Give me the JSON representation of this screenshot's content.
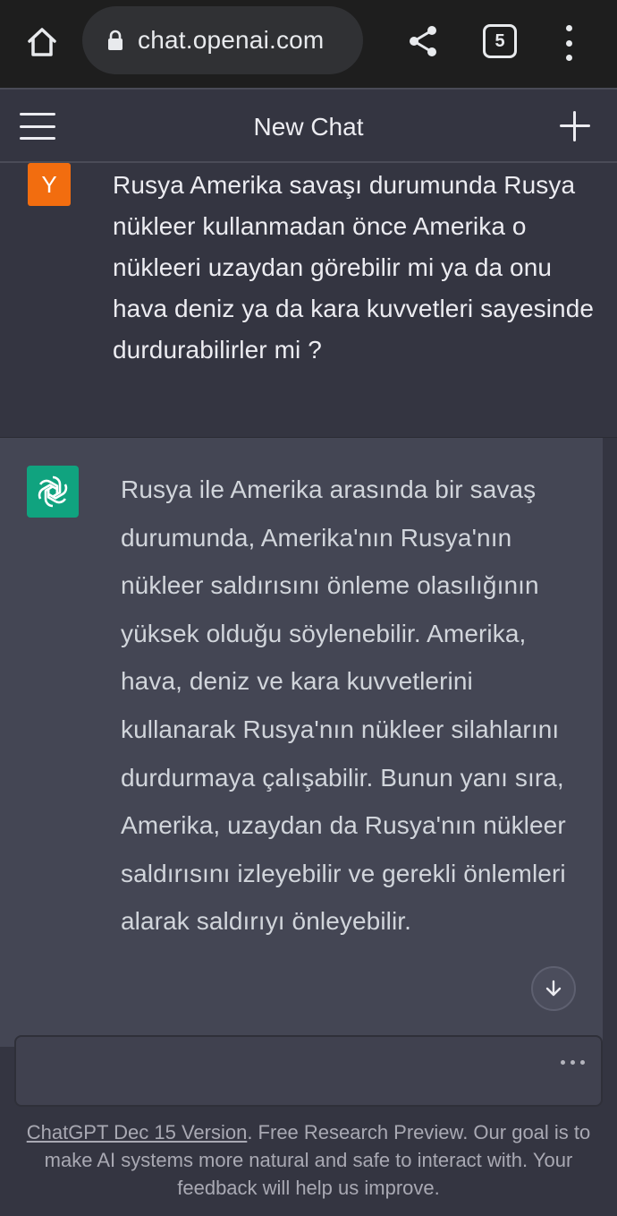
{
  "browser": {
    "url": "chat.openai.com",
    "tab_count": "5"
  },
  "header": {
    "title": "New Chat"
  },
  "conversation": {
    "user_avatar_letter": "Y",
    "user_message": "Rusya Amerika savaşı durumunda Rusya nükleer kullanmadan önce Amerika o nükleeri uzaydan görebilir mi ya da onu hava deniz ya da kara kuvvetleri sayesinde durdurabilirler mi ?",
    "assistant_message": "Rusya ile Amerika arasında bir savaş durumunda, Amerika'nın Rusya'nın nükleer saldırısını önleme olasılığının yüksek olduğu söylenebilir. Amerika, hava, deniz ve kara kuvvetlerini kullanarak Rusya'nın nükleer silahlarını durdurmaya çalışabilir. Bunun yanı sıra, Amerika, uzaydan da Rusya'nın nükleer saldırısını izleyebilir ve gerekli önlemleri alarak saldırıyı önleyebilir."
  },
  "footer": {
    "version_link": "ChatGPT Dec 15 Version",
    "text": ". Free Research Preview. Our goal is to make AI systems more natural and safe to interact with. Your feedback will help us improve."
  },
  "colors": {
    "user_avatar": "#f26d0f",
    "assistant_avatar": "#10a37f",
    "background": "#343541",
    "assistant_bg": "#444654"
  },
  "icons": [
    "home-icon",
    "lock-icon",
    "share-icon",
    "tabs-icon",
    "more-vert-icon",
    "menu-icon",
    "plus-icon",
    "openai-logo-icon",
    "arrow-down-icon"
  ]
}
